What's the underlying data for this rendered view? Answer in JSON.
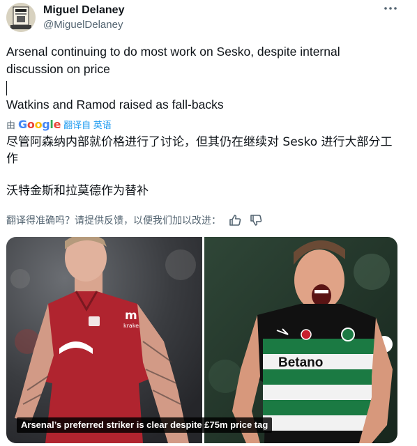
{
  "author": {
    "name": "Miguel Delaney",
    "handle": "@MiguelDelaney"
  },
  "more_icon": "more-horizontal-icon",
  "tweet": {
    "text_line1": "Arsenal continuing to do most work on Sesko, despite internal discussion on price",
    "text_line2": "Watkins and Ramod raised as fall-backs"
  },
  "translation": {
    "by": "由",
    "provider": "Google",
    "label": "翻译自 英语",
    "text_line1": "尽管阿森纳内部就价格进行了讨论，但其仍在继续对 Sesko 进行大部分工作",
    "text_line2": "沃特金斯和拉莫德作为替补",
    "feedback_prompt": "翻译得准确吗？请提供反馈，以便我们加以改进：",
    "thumbs_up_icon": "thumbs-up-icon",
    "thumbs_down_icon": "thumbs-down-icon"
  },
  "media": {
    "caption": "Arsenal’s preferred striker is clear despite £75m price tag",
    "left_shirt_text": "kraken",
    "right_shirt_text": "Betano",
    "colors": {
      "left_kit": "#b0242f",
      "right_kit_green": "#1b7a43",
      "right_kit_black": "#111111"
    }
  },
  "colors": {
    "text": "#0f1419",
    "secondary": "#536471",
    "link": "#1d9bf0"
  }
}
